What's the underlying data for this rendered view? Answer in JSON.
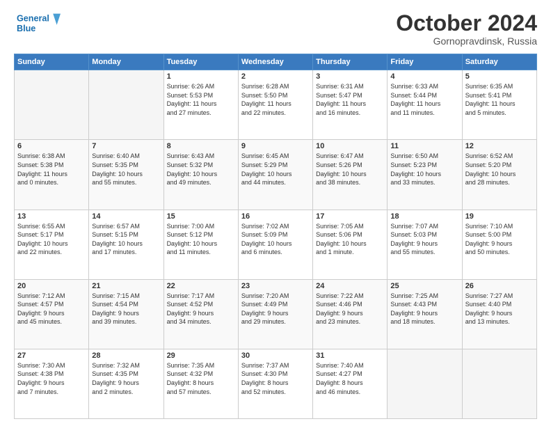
{
  "header": {
    "logo_line1": "General",
    "logo_line2": "Blue",
    "title": "October 2024",
    "subtitle": "Gornopravdinsk, Russia"
  },
  "weekdays": [
    "Sunday",
    "Monday",
    "Tuesday",
    "Wednesday",
    "Thursday",
    "Friday",
    "Saturday"
  ],
  "weeks": [
    [
      {
        "day": "",
        "info": ""
      },
      {
        "day": "",
        "info": ""
      },
      {
        "day": "1",
        "info": "Sunrise: 6:26 AM\nSunset: 5:53 PM\nDaylight: 11 hours\nand 27 minutes."
      },
      {
        "day": "2",
        "info": "Sunrise: 6:28 AM\nSunset: 5:50 PM\nDaylight: 11 hours\nand 22 minutes."
      },
      {
        "day": "3",
        "info": "Sunrise: 6:31 AM\nSunset: 5:47 PM\nDaylight: 11 hours\nand 16 minutes."
      },
      {
        "day": "4",
        "info": "Sunrise: 6:33 AM\nSunset: 5:44 PM\nDaylight: 11 hours\nand 11 minutes."
      },
      {
        "day": "5",
        "info": "Sunrise: 6:35 AM\nSunset: 5:41 PM\nDaylight: 11 hours\nand 5 minutes."
      }
    ],
    [
      {
        "day": "6",
        "info": "Sunrise: 6:38 AM\nSunset: 5:38 PM\nDaylight: 11 hours\nand 0 minutes."
      },
      {
        "day": "7",
        "info": "Sunrise: 6:40 AM\nSunset: 5:35 PM\nDaylight: 10 hours\nand 55 minutes."
      },
      {
        "day": "8",
        "info": "Sunrise: 6:43 AM\nSunset: 5:32 PM\nDaylight: 10 hours\nand 49 minutes."
      },
      {
        "day": "9",
        "info": "Sunrise: 6:45 AM\nSunset: 5:29 PM\nDaylight: 10 hours\nand 44 minutes."
      },
      {
        "day": "10",
        "info": "Sunrise: 6:47 AM\nSunset: 5:26 PM\nDaylight: 10 hours\nand 38 minutes."
      },
      {
        "day": "11",
        "info": "Sunrise: 6:50 AM\nSunset: 5:23 PM\nDaylight: 10 hours\nand 33 minutes."
      },
      {
        "day": "12",
        "info": "Sunrise: 6:52 AM\nSunset: 5:20 PM\nDaylight: 10 hours\nand 28 minutes."
      }
    ],
    [
      {
        "day": "13",
        "info": "Sunrise: 6:55 AM\nSunset: 5:17 PM\nDaylight: 10 hours\nand 22 minutes."
      },
      {
        "day": "14",
        "info": "Sunrise: 6:57 AM\nSunset: 5:15 PM\nDaylight: 10 hours\nand 17 minutes."
      },
      {
        "day": "15",
        "info": "Sunrise: 7:00 AM\nSunset: 5:12 PM\nDaylight: 10 hours\nand 11 minutes."
      },
      {
        "day": "16",
        "info": "Sunrise: 7:02 AM\nSunset: 5:09 PM\nDaylight: 10 hours\nand 6 minutes."
      },
      {
        "day": "17",
        "info": "Sunrise: 7:05 AM\nSunset: 5:06 PM\nDaylight: 10 hours\nand 1 minute."
      },
      {
        "day": "18",
        "info": "Sunrise: 7:07 AM\nSunset: 5:03 PM\nDaylight: 9 hours\nand 55 minutes."
      },
      {
        "day": "19",
        "info": "Sunrise: 7:10 AM\nSunset: 5:00 PM\nDaylight: 9 hours\nand 50 minutes."
      }
    ],
    [
      {
        "day": "20",
        "info": "Sunrise: 7:12 AM\nSunset: 4:57 PM\nDaylight: 9 hours\nand 45 minutes."
      },
      {
        "day": "21",
        "info": "Sunrise: 7:15 AM\nSunset: 4:54 PM\nDaylight: 9 hours\nand 39 minutes."
      },
      {
        "day": "22",
        "info": "Sunrise: 7:17 AM\nSunset: 4:52 PM\nDaylight: 9 hours\nand 34 minutes."
      },
      {
        "day": "23",
        "info": "Sunrise: 7:20 AM\nSunset: 4:49 PM\nDaylight: 9 hours\nand 29 minutes."
      },
      {
        "day": "24",
        "info": "Sunrise: 7:22 AM\nSunset: 4:46 PM\nDaylight: 9 hours\nand 23 minutes."
      },
      {
        "day": "25",
        "info": "Sunrise: 7:25 AM\nSunset: 4:43 PM\nDaylight: 9 hours\nand 18 minutes."
      },
      {
        "day": "26",
        "info": "Sunrise: 7:27 AM\nSunset: 4:40 PM\nDaylight: 9 hours\nand 13 minutes."
      }
    ],
    [
      {
        "day": "27",
        "info": "Sunrise: 7:30 AM\nSunset: 4:38 PM\nDaylight: 9 hours\nand 7 minutes."
      },
      {
        "day": "28",
        "info": "Sunrise: 7:32 AM\nSunset: 4:35 PM\nDaylight: 9 hours\nand 2 minutes."
      },
      {
        "day": "29",
        "info": "Sunrise: 7:35 AM\nSunset: 4:32 PM\nDaylight: 8 hours\nand 57 minutes."
      },
      {
        "day": "30",
        "info": "Sunrise: 7:37 AM\nSunset: 4:30 PM\nDaylight: 8 hours\nand 52 minutes."
      },
      {
        "day": "31",
        "info": "Sunrise: 7:40 AM\nSunset: 4:27 PM\nDaylight: 8 hours\nand 46 minutes."
      },
      {
        "day": "",
        "info": ""
      },
      {
        "day": "",
        "info": ""
      }
    ]
  ]
}
